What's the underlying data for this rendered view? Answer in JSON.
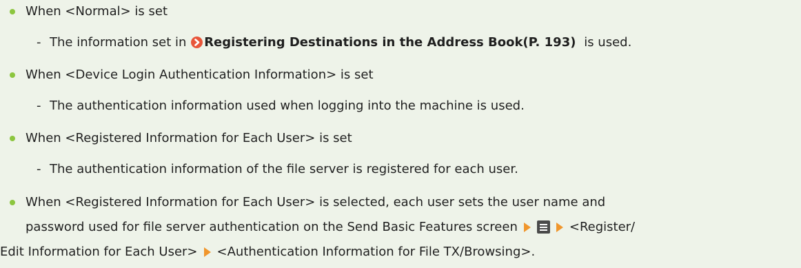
{
  "items": [
    {
      "bullet": "When <Normal> is set",
      "sub": {
        "before": "The information set in",
        "link": "Registering Destinations in the Address Book(P. 193)",
        "after": "is used."
      }
    },
    {
      "bullet": "When <Device Login Authentication Information> is set",
      "sub": {
        "text": "The authentication information used when logging into the machine is used."
      }
    },
    {
      "bullet": "When <Registered Information for Each User> is set",
      "sub": {
        "text": "The authentication information of the file server is registered for each user."
      }
    },
    {
      "line1": "When <Registered Information for Each User> is selected, each user sets the user name and",
      "line2": "password used for file server authentication on the Send Basic Features screen",
      "step_register": "<Register/",
      "line3": "Edit Information for Each User>",
      "step_auth": "<Authentication Information for File TX/Browsing>."
    }
  ],
  "colors": {
    "background": "#eef3e9",
    "bullet": "#8cc63f",
    "arrow": "#f0962c",
    "link_icon": "#e8553a"
  },
  "icons": {
    "link": "circle-arrow-link-icon",
    "step": "orange-triangle-arrow-icon",
    "menu": "hamburger-menu-icon"
  }
}
